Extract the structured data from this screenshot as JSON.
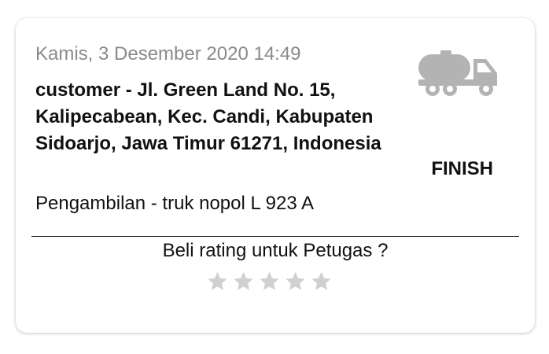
{
  "order": {
    "date": "Kamis, 3 Desember 2020 14:49",
    "address": "customer - Jl. Green Land No. 15, Kalipecabean, Kec. Candi, Kabupaten Sidoarjo, Jawa Timur 61271, Indonesia",
    "vehicle": "Pengambilan - truk nopol L 923 A",
    "status": "FINISH",
    "icon": "tanker-truck-icon"
  },
  "rating": {
    "prompt": "Beli rating untuk Petugas ?",
    "max_stars": 5,
    "value": 0
  },
  "colors": {
    "date_text": "#8a8a8a",
    "icon": "#b3b3b3",
    "star_empty": "#d0d0d0"
  }
}
